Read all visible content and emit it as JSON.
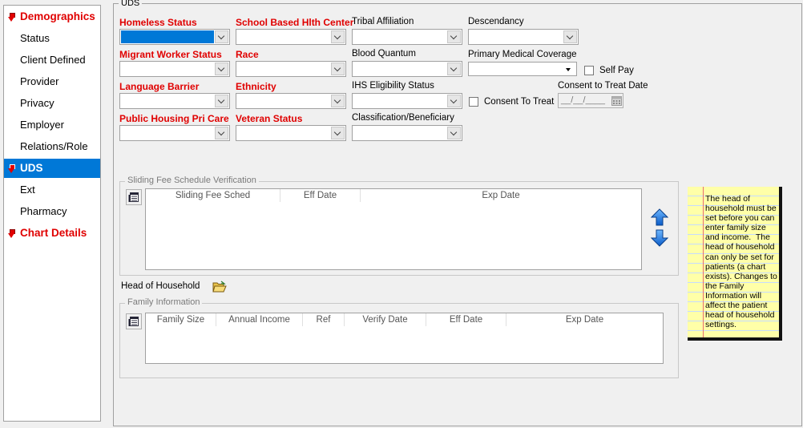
{
  "sidebar": {
    "items": [
      {
        "label": "Demographics",
        "kind": "section"
      },
      {
        "label": "Status"
      },
      {
        "label": "Client Defined"
      },
      {
        "label": "Provider"
      },
      {
        "label": "Privacy"
      },
      {
        "label": "Employer"
      },
      {
        "label": "Relations/Role"
      },
      {
        "label": "UDS",
        "kind": "section",
        "selected": true
      },
      {
        "label": "Ext"
      },
      {
        "label": "Pharmacy"
      },
      {
        "label": "Chart Details",
        "kind": "section"
      }
    ]
  },
  "uds": {
    "title": "UDS",
    "fields": {
      "homeless_status": {
        "label": "Homeless Status",
        "required": true,
        "value": ""
      },
      "school_based": {
        "label": "School Based Hlth Center",
        "required": true,
        "value": ""
      },
      "tribal_affiliation": {
        "label": "Tribal Affiliation",
        "value": ""
      },
      "descendancy": {
        "label": "Descendancy",
        "value": ""
      },
      "migrant_worker": {
        "label": "Migrant Worker Status",
        "required": true,
        "value": ""
      },
      "race": {
        "label": "Race",
        "required": true,
        "value": ""
      },
      "blood_quantum": {
        "label": "Blood Quantum",
        "value": ""
      },
      "primary_medical_coverage": {
        "label": "Primary Medical Coverage",
        "value": ""
      },
      "self_pay": {
        "label": "Self Pay",
        "checked": false
      },
      "language_barrier": {
        "label": "Language Barrier",
        "required": true,
        "value": ""
      },
      "ethnicity": {
        "label": "Ethnicity",
        "required": true,
        "value": ""
      },
      "ihs_eligibility": {
        "label": "IHS Eligibility Status",
        "value": ""
      },
      "consent_to_treat": {
        "label": "Consent To Treat",
        "checked": false
      },
      "consent_date": {
        "label": "Consent to Treat Date",
        "value": "__/__/____"
      },
      "public_housing": {
        "label": "Public Housing Pri Care",
        "required": true,
        "value": ""
      },
      "veteran_status": {
        "label": "Veteran Status",
        "required": true,
        "value": ""
      },
      "classification": {
        "label": "Classification/Beneficiary",
        "value": ""
      }
    },
    "sliding_fee": {
      "title": "Sliding Fee Schedule Verification",
      "columns": [
        "Sliding Fee Sched",
        "Eff Date",
        "Exp Date"
      ],
      "rows": []
    },
    "head_of_household": {
      "label": "Head of Household"
    },
    "family_info": {
      "title": "Family Information",
      "columns": [
        "Family Size",
        "Annual Income",
        "Ref",
        "Verify Date",
        "Eff Date",
        "Exp Date"
      ],
      "rows": []
    },
    "note": "The head of household must be set before you can enter family size and income.  The head of household can only be set for patients (a chart exists). Changes to the Family Information will affect the patient head of household settings."
  },
  "colors": {
    "accent": "#0078d7",
    "required": "#e00000",
    "note_bg": "#ffffa8"
  }
}
